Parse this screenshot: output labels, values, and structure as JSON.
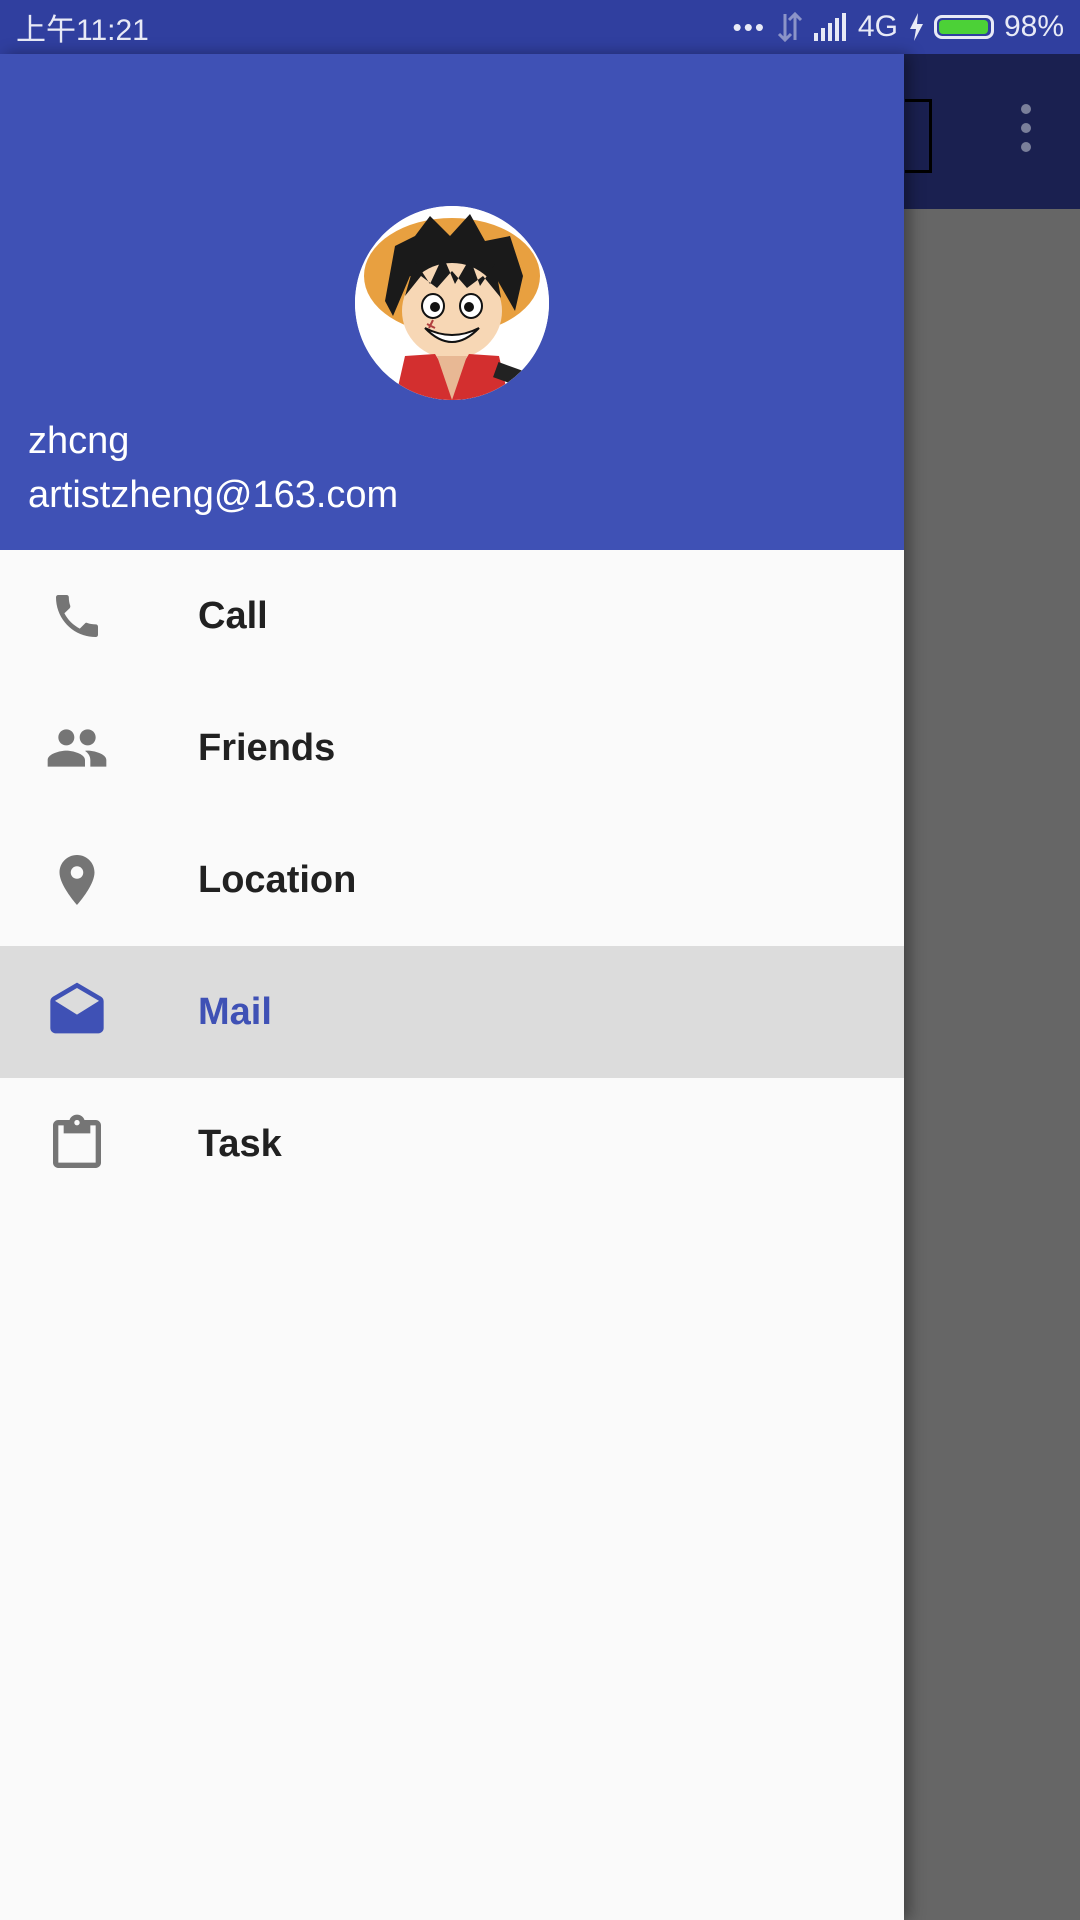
{
  "status_bar": {
    "time": "上午11:21",
    "dots": "•••",
    "network": "4G",
    "battery_pct": "98%",
    "battery_level": 0.98
  },
  "drawer": {
    "header": {
      "user_name": "zhcng",
      "user_email": "artistzheng@163.com",
      "avatar_icon": "luffy-avatar-icon"
    },
    "menu": [
      {
        "label": "Call",
        "icon": "phone-icon",
        "selected": false
      },
      {
        "label": "Friends",
        "icon": "people-icon",
        "selected": false
      },
      {
        "label": "Location",
        "icon": "location-pin-icon",
        "selected": false
      },
      {
        "label": "Mail",
        "icon": "mail-open-icon",
        "selected": true
      },
      {
        "label": "Task",
        "icon": "clipboard-icon",
        "selected": false
      }
    ]
  },
  "colors": {
    "primary": "#3f51b5",
    "primary_dark": "#303f9f",
    "icon_gray": "#757575",
    "selected_bg": "#dcdcdc"
  }
}
